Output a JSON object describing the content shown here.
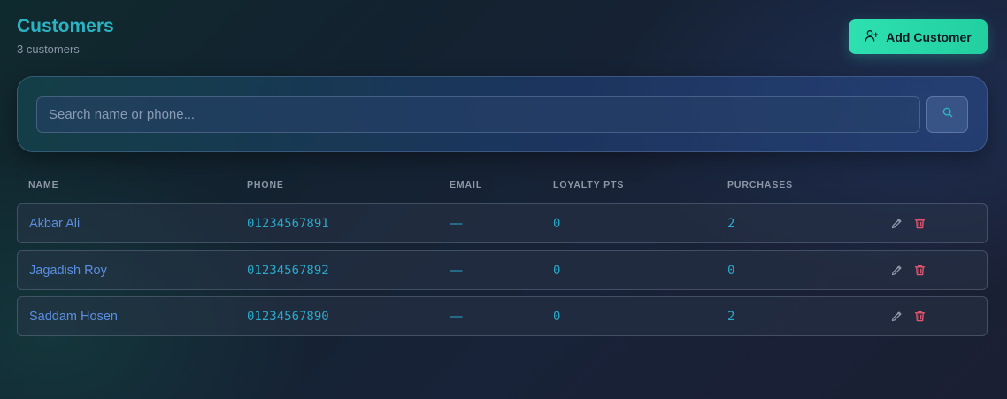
{
  "header": {
    "title": "Customers",
    "subtitle": "3 customers",
    "add_label": "Add Customer"
  },
  "search": {
    "placeholder": "Search name or phone...",
    "value": ""
  },
  "table": {
    "columns": [
      "NAME",
      "PHONE",
      "EMAIL",
      "LOYALTY PTS",
      "PURCHASES"
    ],
    "rows": [
      {
        "name": "Akbar Ali",
        "phone": "01234567891",
        "email": "—",
        "loyalty": "0",
        "purchases": "2"
      },
      {
        "name": "Jagadish Roy",
        "phone": "01234567892",
        "email": "—",
        "loyalty": "0",
        "purchases": "0"
      },
      {
        "name": "Saddam Hosen",
        "phone": "01234567890",
        "email": "—",
        "loyalty": "0",
        "purchases": "2"
      }
    ]
  },
  "colors": {
    "accent": "#2ee0b0",
    "title": "#2bb3c4",
    "name_link": "#5b8de0",
    "value": "#2aa8c8",
    "delete": "#e0566e"
  },
  "icons": {
    "add": "user-plus-icon",
    "search": "search-icon",
    "edit": "pencil-icon",
    "delete": "trash-icon"
  }
}
